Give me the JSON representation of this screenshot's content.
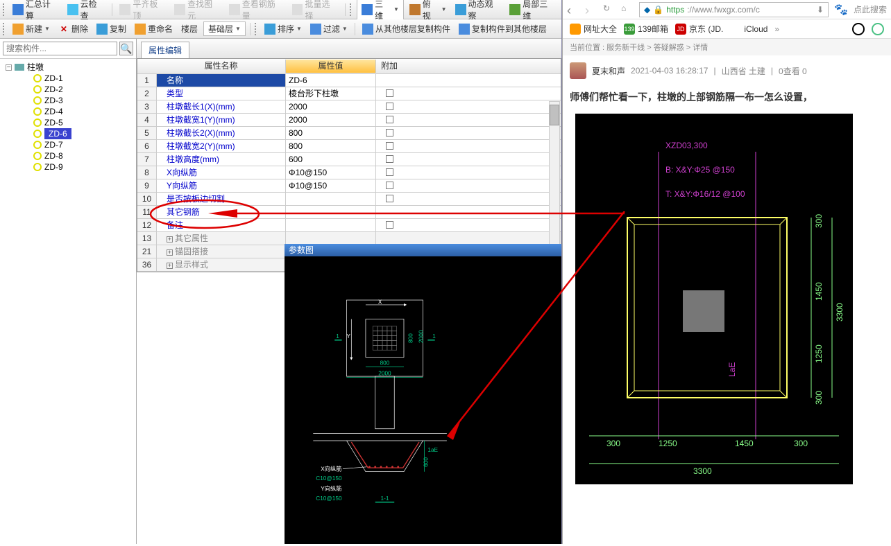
{
  "toolbars": {
    "row1": {
      "sumcalc": "汇总计算",
      "cloudcheck": "云检查",
      "flatbalance": "平齐板顶",
      "findview": "查找图元",
      "viewrebar": "查看钢筋量",
      "batchsel": "批量选择",
      "view3d": "三维",
      "overlook": "俯视",
      "dynview": "动态观察",
      "local3d": "局部三维"
    },
    "row2": {
      "newbtn": "新建",
      "delbtn": "删除",
      "copybtn": "复制",
      "renamebtn": "重命名",
      "layerbtn": "楼层",
      "baselayer": "基础层",
      "sortbtn": "排序",
      "filterbtn": "过滤",
      "copyfrom": "从其他楼层复制构件",
      "copyto": "复制构件到其他楼层"
    }
  },
  "search": {
    "placeholder": "搜索构件..."
  },
  "tree": {
    "root": "柱墩",
    "items": [
      "ZD-1",
      "ZD-2",
      "ZD-3",
      "ZD-4",
      "ZD-5",
      "ZD-6",
      "ZD-7",
      "ZD-8",
      "ZD-9"
    ],
    "selectedIndex": 5
  },
  "propTab": "属性编辑",
  "propHeaders": {
    "name": "属性名称",
    "value": "属性值",
    "add": "附加"
  },
  "props": [
    {
      "n": "1",
      "name": "名称",
      "val": "ZD-6",
      "sel": true
    },
    {
      "n": "2",
      "name": "类型",
      "val": "棱台形下柱墩",
      "chk": true
    },
    {
      "n": "3",
      "name": "柱墩截长1(X)(mm)",
      "val": "2000",
      "chk": true
    },
    {
      "n": "4",
      "name": "柱墩截宽1(Y)(mm)",
      "val": "2000",
      "chk": true
    },
    {
      "n": "5",
      "name": "柱墩截长2(X)(mm)",
      "val": "800",
      "chk": true
    },
    {
      "n": "6",
      "name": "柱墩截宽2(Y)(mm)",
      "val": "800",
      "chk": true
    },
    {
      "n": "7",
      "name": "柱墩高度(mm)",
      "val": "600",
      "chk": true
    },
    {
      "n": "8",
      "name": "X向纵筋",
      "val": "Φ10@150",
      "chk": true
    },
    {
      "n": "9",
      "name": "Y向纵筋",
      "val": "Φ10@150",
      "chk": true
    },
    {
      "n": "10",
      "name": "是否按板边切割",
      "val": "",
      "chk": true
    },
    {
      "n": "11",
      "name": "其它钢筋",
      "val": ""
    },
    {
      "n": "12",
      "name": "备注",
      "val": "",
      "chk": true
    },
    {
      "n": "13",
      "name": "其它属性",
      "val": "",
      "gray": true,
      "plus": true
    },
    {
      "n": "21",
      "name": "锚固搭接",
      "val": "",
      "gray": true,
      "plus": true
    },
    {
      "n": "36",
      "name": "显示样式",
      "val": "",
      "gray": true,
      "plus": true
    }
  ],
  "paramTitle": "参数图",
  "paramDiagram": {
    "top": {
      "x_label": "X",
      "y_label": "Y",
      "dim_1": "1",
      "inner_w": "800",
      "inner_h": "800",
      "outer_w": "2000",
      "outer_h": "2000"
    },
    "section": {
      "x_rebar_label": "X向纵筋",
      "x_rebar_val": "C10@150",
      "y_rebar_label": "Y向纵筋",
      "y_rebar_val": "C10@150",
      "h_label": "600",
      "lae": "1aE",
      "section_tag": "1-1"
    }
  },
  "browser": {
    "url_prefix": "https",
    "url_rest": "://www.fwxgx.com/c",
    "search_hint": "点此搜索",
    "bookmarks": {
      "b1": "网址大全",
      "b2": "139邮箱",
      "b3": "京东 (JD.",
      "b4": "iCloud"
    },
    "breadcrumb": "当前位置 :    服务新干线  >  答疑解惑  >  详情",
    "author": "夏末和声",
    "date": "2021-04-03 16:28:17",
    "location": "山西省  土建",
    "views": "0查看  0",
    "title": "师傅们帮忙看一下，柱墩的上部钢筋隔一布一怎么设置，",
    "cad": {
      "tag": "XZD03,300",
      "line_b": "B:  X&Y:Φ25 @150",
      "line_t": "T:  X&Y:Φ16/12 @100",
      "lae": "LaE",
      "d300a": "300",
      "d1450": "1450",
      "d1250": "1250",
      "d300b": "300",
      "hl_300a": "300",
      "hl_1250": "1250",
      "hl_1450": "1450",
      "hl_300b": "300",
      "hl_3300": "3300",
      "hr_3300": "3300"
    }
  }
}
